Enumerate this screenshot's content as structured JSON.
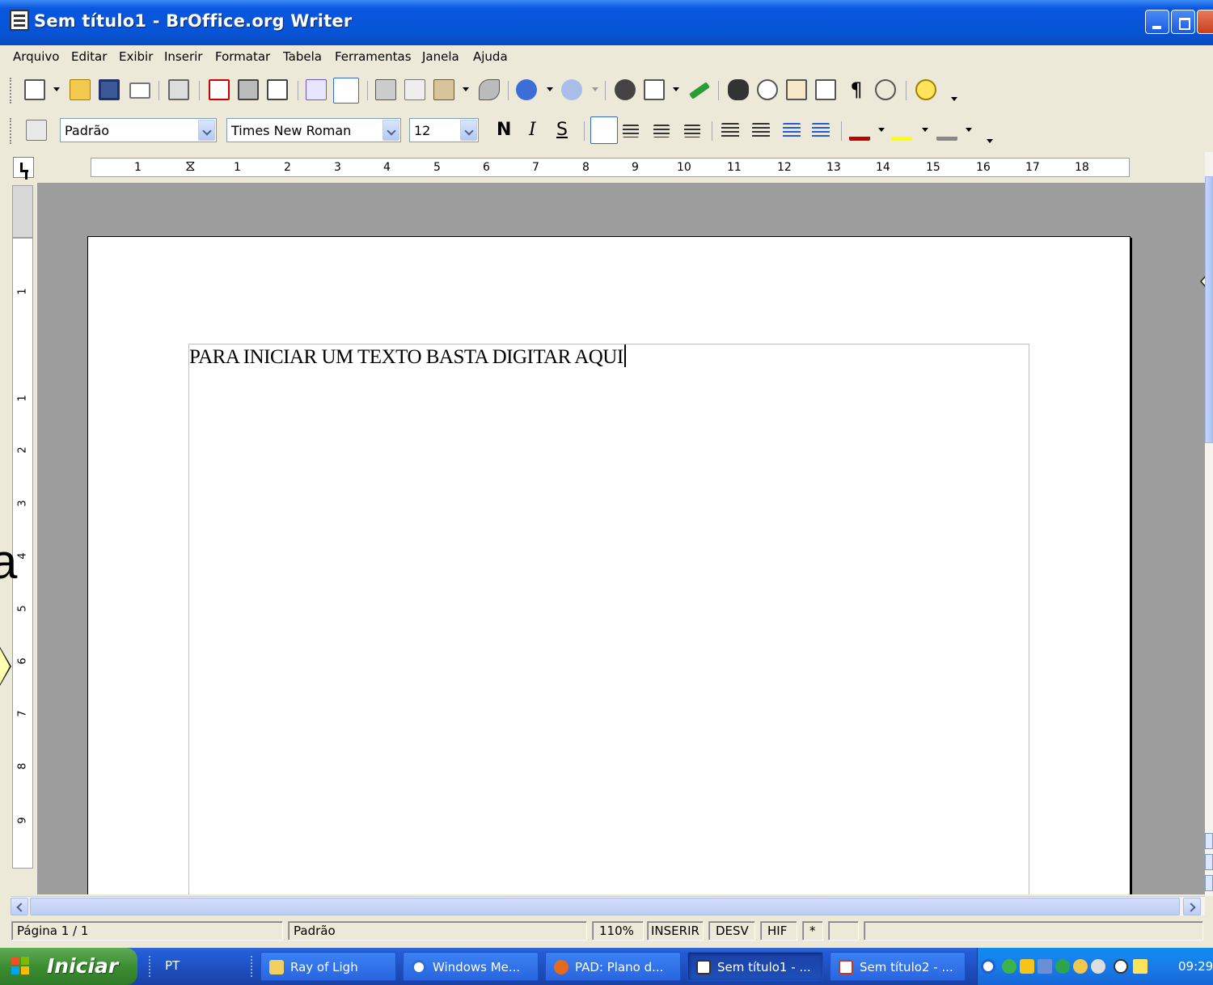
{
  "window": {
    "title": "Sem título1 - BrOffice.org Writer"
  },
  "menu": [
    "Arquivo",
    "Editar",
    "Exibir",
    "Inserir",
    "Formatar",
    "Tabela",
    "Ferramentas",
    "Janela",
    "Ajuda"
  ],
  "formatting": {
    "paragraph_style": "Padrão",
    "font_name": "Times New Roman",
    "font_size": "12",
    "bold_label": "N",
    "italic_label": "I",
    "underline_label": "S"
  },
  "ruler": {
    "horizontal_numbers": [
      "1",
      "1",
      "2",
      "3",
      "4",
      "5",
      "6",
      "7",
      "8",
      "9",
      "10",
      "11",
      "12",
      "13",
      "14",
      "15",
      "16",
      "17",
      "18"
    ],
    "vertical_numbers": [
      "1",
      "1",
      "2",
      "3",
      "4",
      "5",
      "6",
      "7",
      "8",
      "9"
    ]
  },
  "document": {
    "text": "PARA INICIAR UM TEXTO BASTA DIGITAR AQUI"
  },
  "statusbar": {
    "page": "Página 1 / 1",
    "page_style": "Padrão",
    "zoom": "110%",
    "insert_mode": "INSERIR",
    "selection_mode": "DESV",
    "hyperlink_mode": "HIF",
    "modified": "*"
  },
  "taskbar": {
    "start_label": "Iniciar",
    "language": "PT",
    "tasks": [
      {
        "label": "Ray of Ligh",
        "icon": "folder-icon"
      },
      {
        "label": "Windows Me...",
        "icon": "media-player-icon"
      },
      {
        "label": "PAD: Plano d...",
        "icon": "firefox-icon"
      },
      {
        "label": "Sem título1 - ...",
        "icon": "writer-icon"
      },
      {
        "label": "Sem título2 - ...",
        "icon": "writer-icon"
      }
    ],
    "clock": "09:29"
  },
  "edge_fragment": "a",
  "colors": {
    "title_bar": "#0654d6",
    "taskbar": "#245edb",
    "start_button": "#3c8d32",
    "workspace": "#9d9d9d"
  }
}
